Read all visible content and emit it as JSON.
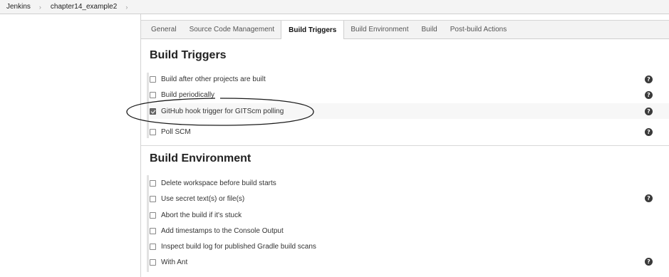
{
  "breadcrumb": {
    "items": [
      "Jenkins",
      "chapter14_example2"
    ],
    "separator": "›"
  },
  "tabs": [
    {
      "label": "General",
      "active": false
    },
    {
      "label": "Source Code Management",
      "active": false
    },
    {
      "label": "Build Triggers",
      "active": true
    },
    {
      "label": "Build Environment",
      "active": false
    },
    {
      "label": "Build",
      "active": false
    },
    {
      "label": "Post-build Actions",
      "active": false
    }
  ],
  "build_triggers": {
    "title": "Build Triggers",
    "options": [
      {
        "label": "Build after other projects are built",
        "checked": false,
        "has_help": true
      },
      {
        "label": "Build periodically",
        "checked": false,
        "has_help": true
      },
      {
        "label": "GitHub hook trigger for GITScm polling",
        "checked": true,
        "has_help": true
      },
      {
        "label": "Poll SCM",
        "checked": false,
        "has_help": true
      }
    ]
  },
  "build_environment": {
    "title": "Build Environment",
    "options": [
      {
        "label": "Delete workspace before build starts",
        "checked": false,
        "has_help": false
      },
      {
        "label": "Use secret text(s) or file(s)",
        "checked": false,
        "has_help": true
      },
      {
        "label": "Abort the build if it's stuck",
        "checked": false,
        "has_help": false
      },
      {
        "label": "Add timestamps to the Console Output",
        "checked": false,
        "has_help": false
      },
      {
        "label": "Inspect build log for published Gradle build scans",
        "checked": false,
        "has_help": false
      },
      {
        "label": "With Ant",
        "checked": false,
        "has_help": true
      }
    ]
  },
  "help_glyph": "?",
  "colors": {
    "tabbar_bg": "#f3f3f3",
    "help_icon": "#3a3a3a",
    "annotation_stroke": "#1a1a1a"
  }
}
